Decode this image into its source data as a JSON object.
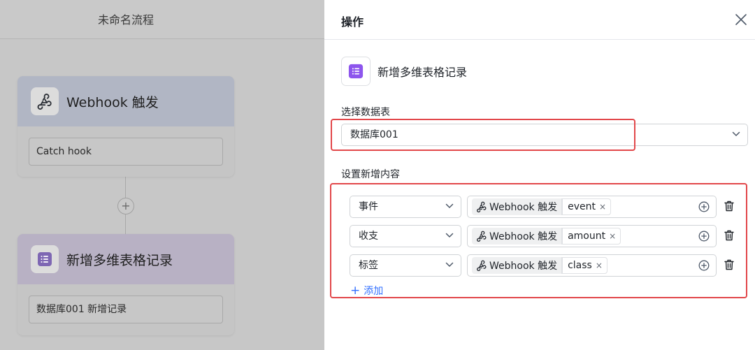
{
  "canvas": {
    "flow_title": "未命名流程",
    "trigger_node": {
      "title": "Webhook 触发",
      "field_value": "Catch hook",
      "icon": "webhook-icon"
    },
    "add_step_symbol": "+",
    "action_node": {
      "title": "新增多维表格记录",
      "field_value": "数据库001 新增记录",
      "icon": "bitable-icon"
    }
  },
  "panel": {
    "title": "操作",
    "close_icon": "close-icon",
    "action": {
      "title": "新增多维表格记录",
      "icon": "bitable-icon"
    },
    "table_label": "选择数据表",
    "table_value": "数据库001",
    "content_label": "设置新增内容",
    "rows": [
      {
        "field": "事件",
        "source": "Webhook 触发",
        "value": "event"
      },
      {
        "field": "收支",
        "source": "Webhook 触发",
        "value": "amount"
      },
      {
        "field": "标签",
        "source": "Webhook 触发",
        "value": "class"
      }
    ],
    "add_label": "添加",
    "chip_remove_symbol": "×"
  },
  "colors": {
    "accent": "#3370ff",
    "highlight": "#e2474a",
    "bitable_purple": "#8d55ed"
  }
}
